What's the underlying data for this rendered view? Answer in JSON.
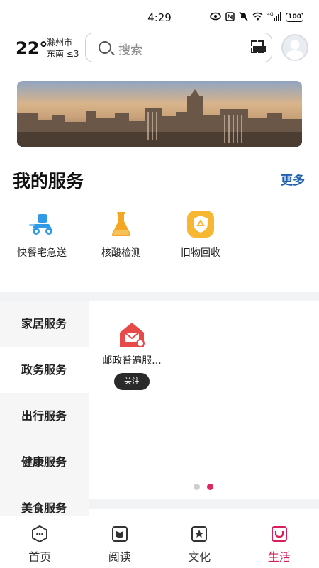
{
  "status_bar": {
    "time": "4:29",
    "network": "4G",
    "battery": "100"
  },
  "weather": {
    "temperature": "22°",
    "city": "滁州市",
    "wind": "东南 ≤3"
  },
  "search": {
    "placeholder": "搜索"
  },
  "my_services": {
    "title": "我的服务",
    "more": "更多",
    "items": [
      {
        "label": "快餐宅急送",
        "icon": "delivery-scooter-icon"
      },
      {
        "label": "核酸检测",
        "icon": "test-flask-icon"
      },
      {
        "label": "旧物回收",
        "icon": "recycle-badge-icon"
      }
    ]
  },
  "categories": {
    "items": [
      "家居服务",
      "政务服务",
      "出行服务",
      "健康服务",
      "美食服务"
    ],
    "active": "家居服务"
  },
  "category_content": {
    "tiles": [
      {
        "label": "邮政普遍服...",
        "button": "关注",
        "icon": "postal-house-icon"
      }
    ],
    "page_indicator": {
      "pages": 2,
      "current": 2
    }
  },
  "bottom_nav": {
    "items": [
      {
        "label": "首页",
        "icon": "home-hexagon-icon"
      },
      {
        "label": "阅读",
        "icon": "book-icon"
      },
      {
        "label": "文化",
        "icon": "star-badge-icon"
      },
      {
        "label": "生活",
        "icon": "shopping-bag-icon"
      }
    ],
    "active": "生活"
  },
  "colors": {
    "accent": "#d81e5b",
    "link": "#1e5fae",
    "service_blue": "#2f9be6",
    "service_orange": "#f5a623",
    "postal_red": "#e84a4a"
  }
}
